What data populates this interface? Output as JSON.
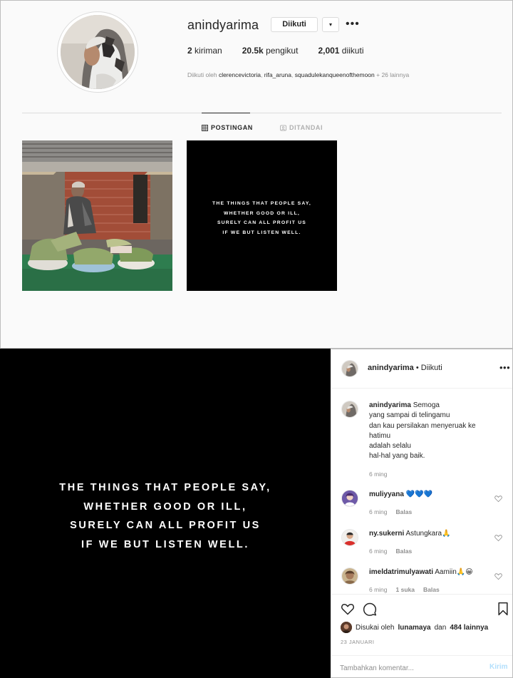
{
  "profile": {
    "username": "anindyarima",
    "follow_button": "Diikuti",
    "dropdown_icon": "▾",
    "more_icon": "•••",
    "stats": [
      {
        "value": "2",
        "label": " kiriman"
      },
      {
        "value": "20.5k",
        "label": " pengikut"
      },
      {
        "value": "2,001",
        "label": " diikuti"
      }
    ],
    "followed_by_prefix": "Diikuti oleh ",
    "followed_by_names": [
      "clerencevictoria",
      "rifa_aruna",
      "squadulekanqueenofthemoon"
    ],
    "followed_by_suffix": " + 26 lainnya"
  },
  "tabs": [
    {
      "label": "POSTINGAN",
      "icon": "grid-icon",
      "active": true
    },
    {
      "label": "DITANDAI",
      "icon": "tag-icon",
      "active": false
    }
  ],
  "thumbnail_quote": [
    "THE THINGS THAT PEOPLE SAY,",
    "WHETHER GOOD OR ILL,",
    "SURELY CAN ALL PROFIT US",
    "IF WE BUT LISTEN WELL."
  ],
  "post": {
    "quote": [
      "THE THINGS THAT PEOPLE SAY,",
      "WHETHER GOOD OR ILL,",
      "SURELY CAN ALL PROFIT US",
      "IF WE BUT LISTEN WELL."
    ],
    "header": {
      "username": "anindyarima",
      "separator": " • ",
      "status": "Diikuti",
      "more_icon": "•••"
    },
    "caption": {
      "username": "anindyarima",
      "lines": [
        "Semoga",
        "yang sampai di telingamu",
        "dan kau persilakan menyeruak ke",
        "hatimu",
        "adalah selalu",
        "hal-hal yang baik."
      ],
      "time": "6 ming"
    },
    "comments": [
      {
        "username": "muliyyana",
        "text": " 💙💙💙",
        "time": "6 ming",
        "likes": "",
        "reply": "Balas"
      },
      {
        "username": "ny.sukerni",
        "text": " Astungkara🙏",
        "time": "6 ming",
        "likes": "",
        "reply": "Balas"
      },
      {
        "username": "imeldatrimulyawati",
        "text": " Aamiin🙏😀",
        "time": "6 ming",
        "likes": "1 suka",
        "reply": "Balas"
      }
    ],
    "likes_prefix": "Disukai oleh ",
    "likes_user": "lunamaya",
    "likes_mid": " dan ",
    "likes_count": "484 lainnya",
    "date": "23 JANUARI",
    "comment_placeholder": "Tambahkan komentar...",
    "send_label": "Kirim"
  },
  "colors": {
    "link_blue": "#b2dffc",
    "text": "#262626",
    "muted": "#8e8e8e",
    "border": "#dbdbdb"
  }
}
